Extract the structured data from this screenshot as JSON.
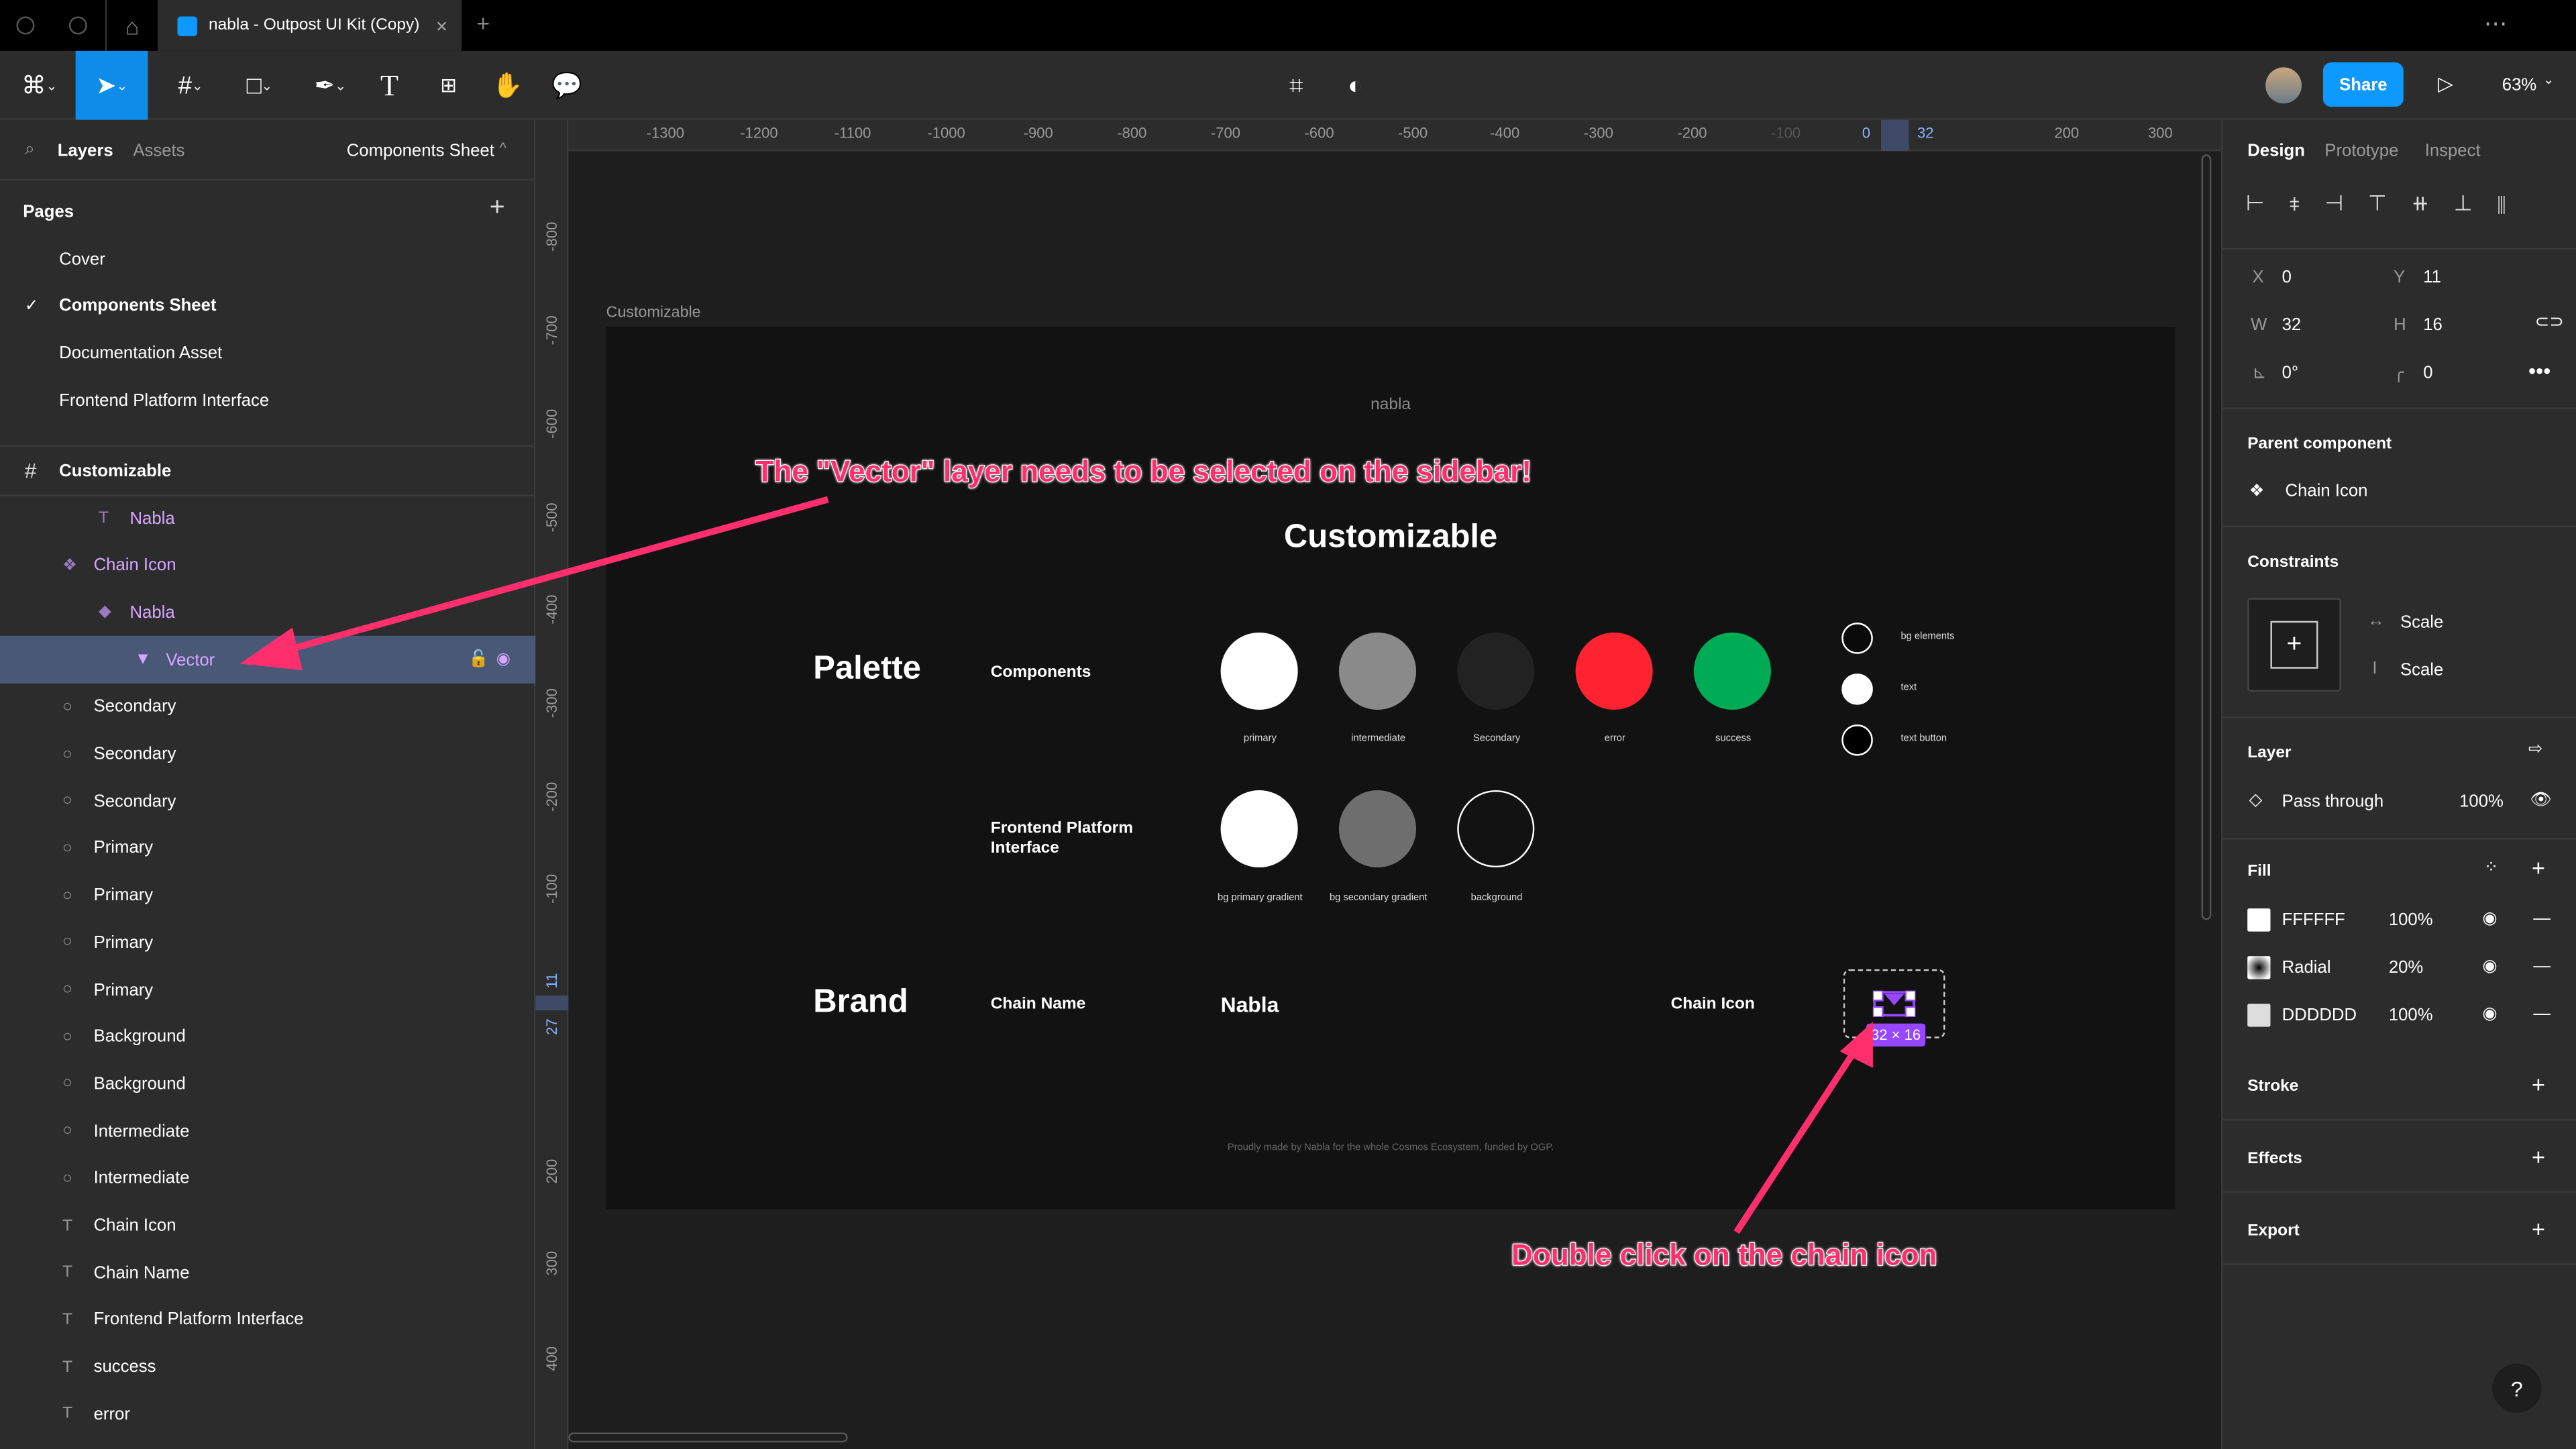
{
  "tabs": {
    "title": "nabla - Outpost UI Kit (Copy)",
    "close": "×",
    "new": "+",
    "more": "⋯"
  },
  "toolbar": {
    "share": "Share",
    "zoom": "63%",
    "play": "▷"
  },
  "left_panel": {
    "tab_layers": "Layers",
    "tab_assets": "Assets",
    "page_selector": "Components Sheet",
    "pages_title": "Pages",
    "add": "+",
    "pages": [
      {
        "label": "Cover",
        "current": false
      },
      {
        "label": "Components Sheet",
        "current": true
      },
      {
        "label": "Documentation Asset",
        "current": false
      },
      {
        "label": "Frontend Platform Interface",
        "current": false
      }
    ],
    "frame_name": "Customizable",
    "layers": [
      {
        "label": "Nabla",
        "icon": "T",
        "type": "text-icon",
        "indent": 2,
        "purple": true
      },
      {
        "label": "Chain Icon",
        "icon": "❖",
        "type": "component-icon",
        "indent": 1,
        "purple": true
      },
      {
        "label": "Nabla",
        "icon": "◆",
        "type": "instance-icon",
        "indent": 2,
        "purple": true
      },
      {
        "label": "Vector",
        "icon": "▼",
        "type": "vector-icon",
        "indent": 3,
        "purple": true,
        "selected": true
      },
      {
        "label": "Secondary",
        "icon": "○",
        "type": "ellipse-icon",
        "indent": 1
      },
      {
        "label": "Secondary",
        "icon": "○",
        "type": "ellipse-icon",
        "indent": 1
      },
      {
        "label": "Secondary",
        "icon": "○",
        "type": "ellipse-icon",
        "indent": 1
      },
      {
        "label": "Primary",
        "icon": "○",
        "type": "ellipse-icon",
        "indent": 1
      },
      {
        "label": "Primary",
        "icon": "○",
        "type": "ellipse-icon",
        "indent": 1
      },
      {
        "label": "Primary",
        "icon": "○",
        "type": "ellipse-icon",
        "indent": 1
      },
      {
        "label": "Primary",
        "icon": "○",
        "type": "ellipse-icon",
        "indent": 1
      },
      {
        "label": "Background",
        "icon": "○",
        "type": "ellipse-icon",
        "indent": 1
      },
      {
        "label": "Background",
        "icon": "○",
        "type": "ellipse-icon",
        "indent": 1
      },
      {
        "label": "Intermediate",
        "icon": "○",
        "type": "ellipse-icon",
        "indent": 1
      },
      {
        "label": "Intermediate",
        "icon": "○",
        "type": "ellipse-icon",
        "indent": 1
      },
      {
        "label": "Chain Icon",
        "icon": "T",
        "type": "text-icon",
        "indent": 1
      },
      {
        "label": "Chain Name",
        "icon": "T",
        "type": "text-icon",
        "indent": 1
      },
      {
        "label": "Frontend Platform Interface",
        "icon": "T",
        "type": "text-icon",
        "indent": 1
      },
      {
        "label": "success",
        "icon": "T",
        "type": "text-icon",
        "indent": 1
      },
      {
        "label": "error",
        "icon": "T",
        "type": "text-icon",
        "indent": 1
      }
    ]
  },
  "rulers": {
    "top": [
      "-1300",
      "-1200",
      "-1100",
      "-1000",
      "-900",
      "-800",
      "-700",
      "-600",
      "-500",
      "-400",
      "-300",
      "-200",
      "-100",
      "0",
      "32",
      "200",
      "300"
    ],
    "left": [
      "-800",
      "-700",
      "-600",
      "-500",
      "-400",
      "-300",
      "-200",
      "-100",
      "11",
      "27",
      "200",
      "300",
      "400"
    ]
  },
  "canvas": {
    "frame_label": "Customizable",
    "brand_small": "nabla",
    "title": "Customizable",
    "palette": "Palette",
    "components": "Components",
    "fpi": "Frontend Platform Interface",
    "swatches": [
      {
        "label": "primary",
        "color": "#FFFFFF"
      },
      {
        "label": "intermediate",
        "color": "#8A8A8A"
      },
      {
        "label": "Secondary",
        "color": "#222222"
      },
      {
        "label": "error",
        "color": "#FF2332"
      },
      {
        "label": "success",
        "color": "#00AB55"
      }
    ],
    "small_swatches": [
      {
        "label": "bg elements",
        "color": "#0A0A0A"
      },
      {
        "label": "text",
        "color": "#FFFFFF"
      },
      {
        "label": "text button",
        "color": "#000000"
      }
    ],
    "fpi_swatches": [
      {
        "label": "bg primary gradient",
        "color": "#FFFFFF"
      },
      {
        "label": "bg secondary gradient",
        "color": "#6E6E6E"
      },
      {
        "label": "background",
        "color": "#121212"
      }
    ],
    "brand": "Brand",
    "chain_name": "Chain Name",
    "nabla": "Nabla",
    "chain_icon": "Chain Icon",
    "size_badge": "32 × 16",
    "footer": "Proudly made by Nabla for the whole Cosmos Ecosystem, funded by OGP."
  },
  "annotations": {
    "top": "The \"Vector\" layer needs to be selected on the sidebar!",
    "bottom": "Double click on the chain icon",
    "color": "#FF2F6E"
  },
  "right_panel": {
    "tab_design": "Design",
    "tab_prototype": "Prototype",
    "tab_inspect": "Inspect",
    "x_label": "X",
    "x": "0",
    "y_label": "Y",
    "y": "11",
    "w_label": "W",
    "w": "32",
    "h_label": "H",
    "h": "16",
    "rotation": "0°",
    "radius": "0",
    "parent_title": "Parent component",
    "parent": "Chain Icon",
    "constraints_title": "Constraints",
    "constraint_h": "Scale",
    "constraint_v": "Scale",
    "layer_title": "Layer",
    "blend": "Pass through",
    "opacity": "100%",
    "fill_title": "Fill",
    "fills": [
      {
        "value": "FFFFFF",
        "opacity": "100%",
        "swatch": "#FFFFFF"
      },
      {
        "value": "Radial",
        "opacity": "20%",
        "swatch": "radial"
      },
      {
        "value": "DDDDDD",
        "opacity": "100%",
        "swatch": "#DDDDDD"
      }
    ],
    "stroke": "Stroke",
    "effects": "Effects",
    "export": "Export",
    "help": "?"
  },
  "colors": {
    "accent": "#0D99FF",
    "selected_layer": "#4A5878",
    "component_purple": "#D7A6FF",
    "selection": "#9747FF"
  }
}
